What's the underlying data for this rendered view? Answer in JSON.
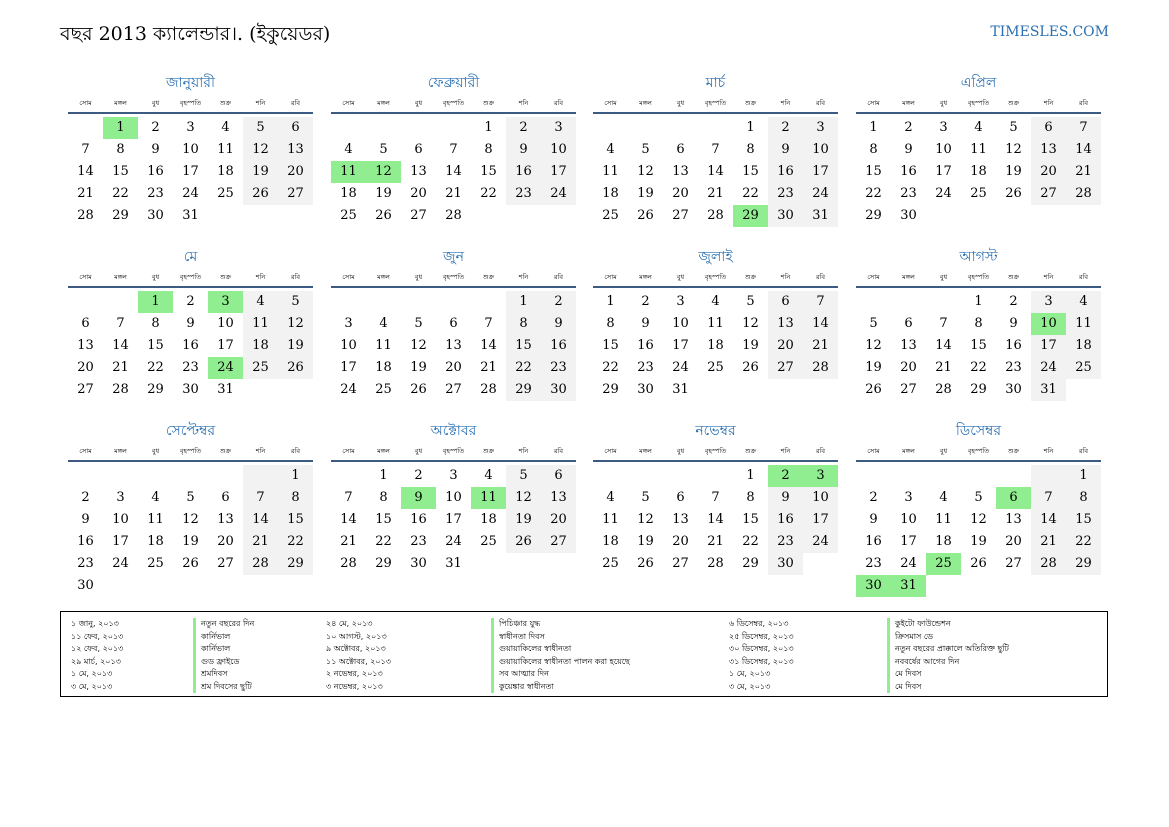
{
  "header": {
    "title": "বছর 2013 ক্যালেন্ডার।. (ইকুয়েডর)",
    "site": "TIMESLES.COM"
  },
  "weekdays": [
    "সোম",
    "মঙ্গল",
    "বুধ",
    "বৃহস্পতি",
    "শুক্র",
    "শনি",
    "রবি"
  ],
  "colors": {
    "accent": "#2a6fb0",
    "holiday": "#90ee90",
    "weekend": "#f2f2f2",
    "rule": "#3d5a80"
  },
  "months": [
    {
      "name": "জানুয়ারী",
      "offset": 1,
      "days": 31,
      "holidays": [
        1
      ]
    },
    {
      "name": "ফেব্রুয়ারী",
      "offset": 4,
      "days": 28,
      "holidays": [
        11,
        12
      ]
    },
    {
      "name": "মার্চ",
      "offset": 4,
      "days": 31,
      "holidays": [
        29
      ]
    },
    {
      "name": "এপ্রিল",
      "offset": 0,
      "days": 30,
      "holidays": []
    },
    {
      "name": "মে",
      "offset": 2,
      "days": 31,
      "holidays": [
        1,
        3,
        24
      ]
    },
    {
      "name": "জুন",
      "offset": 5,
      "days": 30,
      "holidays": []
    },
    {
      "name": "জুলাই",
      "offset": 0,
      "days": 31,
      "holidays": []
    },
    {
      "name": "আগস্ট",
      "offset": 3,
      "days": 31,
      "holidays": [
        10
      ]
    },
    {
      "name": "সেপ্টেম্বর",
      "offset": 6,
      "days": 30,
      "holidays": []
    },
    {
      "name": "অক্টোবর",
      "offset": 1,
      "days": 31,
      "holidays": [
        9,
        11
      ]
    },
    {
      "name": "নভেম্বর",
      "offset": 4,
      "days": 30,
      "holidays": [
        2,
        3
      ]
    },
    {
      "name": "ডিসেম্বর",
      "offset": 6,
      "days": 31,
      "holidays": [
        6,
        25,
        30,
        31
      ]
    }
  ],
  "holiday_list": [
    {
      "dates": [
        "১ জানু, ২০১৩",
        "১১ ফেব, ২০১৩",
        "১২ ফেব, ২০১৩",
        "২৯ মার্চ, ২০১৩",
        "১ মে, ২০১৩",
        "৩ মে, ২০১৩"
      ],
      "names": [
        "নতুন বছরের দিন",
        "কার্নিভাল",
        "কার্নিভাল",
        "গুড ফ্রাইডে",
        "শ্রমদিবস",
        "শ্রম দিবসের ছুটি"
      ]
    },
    {
      "dates": [
        "২৪ মে, ২০১৩",
        "১০ আগস্ট, ২০১৩",
        "৯ অক্টোবর, ২০১৩",
        "১১ অক্টোবর, ২০১৩",
        "২ নভেম্বর, ২০১৩",
        "৩ নভেম্বর, ২০১৩"
      ],
      "names": [
        "পিচিঞ্চার যুদ্ধ",
        "স্বাধীনতা দিবস",
        "গুয়ায়াকিলের স্বাধীনতা",
        "গুয়ায়াকিলের স্বাধীনতা পালন করা হয়েছে",
        "সব আত্মার দিন",
        "কুয়েঙ্কার স্বাধীনতা"
      ]
    },
    {
      "dates": [
        "৬ ডিসেম্বর, ২০১৩",
        "২৫ ডিসেম্বর, ২০১৩",
        "৩০ ডিসেম্বর, ২০১৩",
        "৩১ ডিসেম্বর, ২০১৩",
        "১ মে, ২০১৩",
        "৩ মে, ২০১৩"
      ],
      "names": [
        "কুইটো ফাউন্ডেশন",
        "ক্রিসমাস ডে",
        "নতুন বছরের প্রাক্কালে অতিরিক্ত ছুটি",
        "নববর্ষের আগের দিন",
        "মে দিবস",
        "মে দিবস"
      ]
    }
  ]
}
